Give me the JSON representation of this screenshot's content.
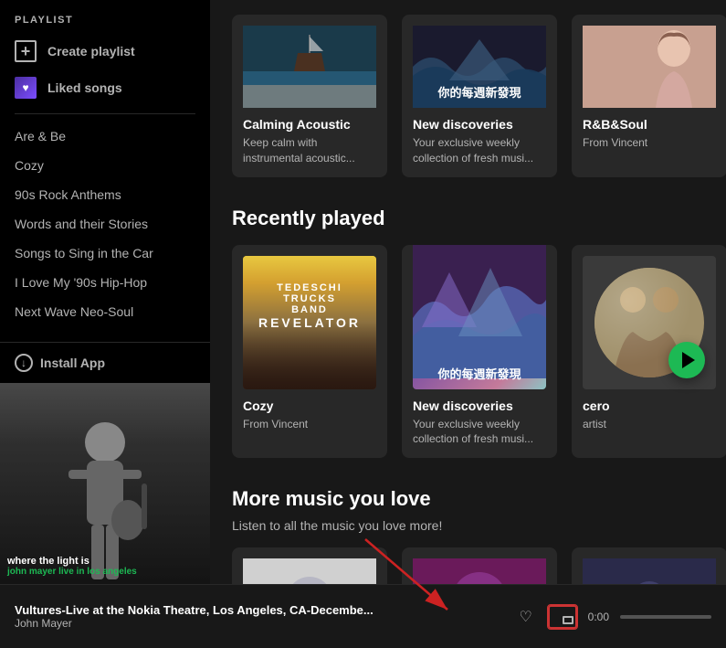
{
  "sidebar": {
    "section_label": "PLAYLIST",
    "create_playlist_label": "Create playlist",
    "liked_songs_label": "Liked songs",
    "playlists": [
      {
        "label": "Are & Be"
      },
      {
        "label": "Cozy"
      },
      {
        "label": "90s Rock Anthems"
      },
      {
        "label": "Words and their Stories"
      },
      {
        "label": "Songs to Sing in the Car"
      },
      {
        "label": "I Love My '90s Hip-Hop"
      },
      {
        "label": "Next Wave Neo-Soul"
      }
    ],
    "install_app_label": "Install App",
    "now_playing_title": "where the light is",
    "now_playing_artist": "john mayer live in los angeles"
  },
  "top_cards": [
    {
      "title": "Calming Acoustic",
      "description": "Keep calm with instrumental acoustic...",
      "type": "calming"
    },
    {
      "title": "New discoveries",
      "description": "Your exclusive weekly collection of fresh musi...",
      "chinese_text": "你的每週新發現",
      "type": "new_disc"
    },
    {
      "title": "R&B&Soul",
      "description": "From Vincent",
      "type": "rnb"
    }
  ],
  "recently_played": {
    "section_title": "Recently played",
    "cards": [
      {
        "title": "Cozy",
        "description": "From Vincent",
        "type": "cozy",
        "band_name": "TEDESCHI\nTRUCKS\nBAND",
        "album": "REVELATOR"
      },
      {
        "title": "New discoveries",
        "description": "Your exclusive weekly collection of fresh musi...",
        "chinese_text": "你的每週新發現",
        "type": "new_disc_large"
      },
      {
        "title": "cero",
        "description": "artist",
        "type": "cero",
        "has_play_btn": true
      }
    ]
  },
  "more_music": {
    "section_title": "More music you love",
    "subtitle": "Listen to all the music you love more!",
    "cards": [
      {
        "type": "more1"
      },
      {
        "type": "more2"
      },
      {
        "type": "more3"
      }
    ]
  },
  "bottom_bar": {
    "track_title": "Vultures-Live at the Nokia Theatre, Los Angeles, CA-Decembe...",
    "artist": "John Mayer",
    "time": "0:00",
    "heart_icon": "♡",
    "pip_icon": "⊡"
  },
  "annotation": {
    "arrow_label": "red arrow pointing to pip button"
  }
}
